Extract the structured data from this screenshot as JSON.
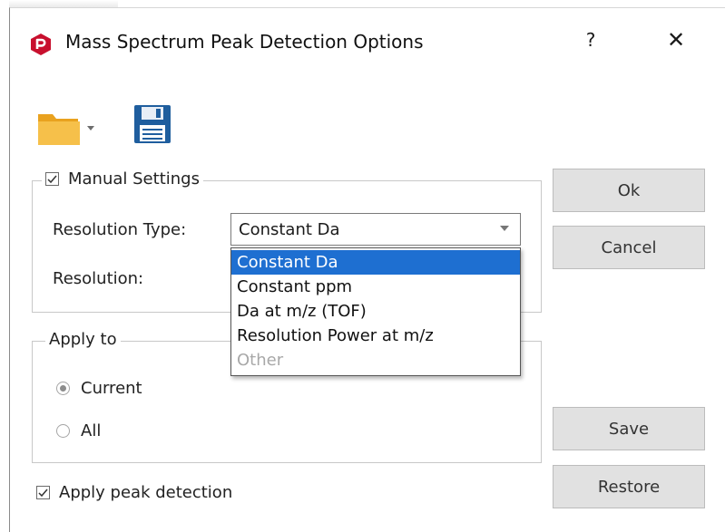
{
  "window": {
    "title": "Mass Spectrum Peak Detection Options",
    "help_label": "?",
    "close_label": "✕",
    "accent": "#c8102e"
  },
  "toolbar": {
    "open_icon": "folder-open-icon",
    "save_icon": "floppy-save-icon"
  },
  "manual_settings": {
    "legend": "Manual Settings",
    "checked": true,
    "resolution_type_label": "Resolution Type:",
    "resolution_type_value": "Constant Da",
    "resolution_label": "Resolution:",
    "dropdown_options": [
      {
        "label": "Constant Da",
        "state": "selected"
      },
      {
        "label": "Constant ppm",
        "state": "normal"
      },
      {
        "label": "Da at m/z (TOF)",
        "state": "normal"
      },
      {
        "label": "Resolution Power at m/z",
        "state": "normal"
      },
      {
        "label": "Other",
        "state": "disabled"
      }
    ]
  },
  "apply_to": {
    "legend": "Apply to",
    "options": [
      {
        "label": "Current",
        "selected": true
      },
      {
        "label": "All",
        "selected": false
      }
    ]
  },
  "buttons": {
    "ok": "Ok",
    "cancel": "Cancel",
    "save": "Save",
    "restore": "Restore"
  },
  "apply_peak_detection": {
    "label": "Apply peak detection",
    "checked": true
  },
  "colors": {
    "selection": "#1e6fd1",
    "folder": "#f2b233",
    "floppy": "#1f5e9e"
  }
}
